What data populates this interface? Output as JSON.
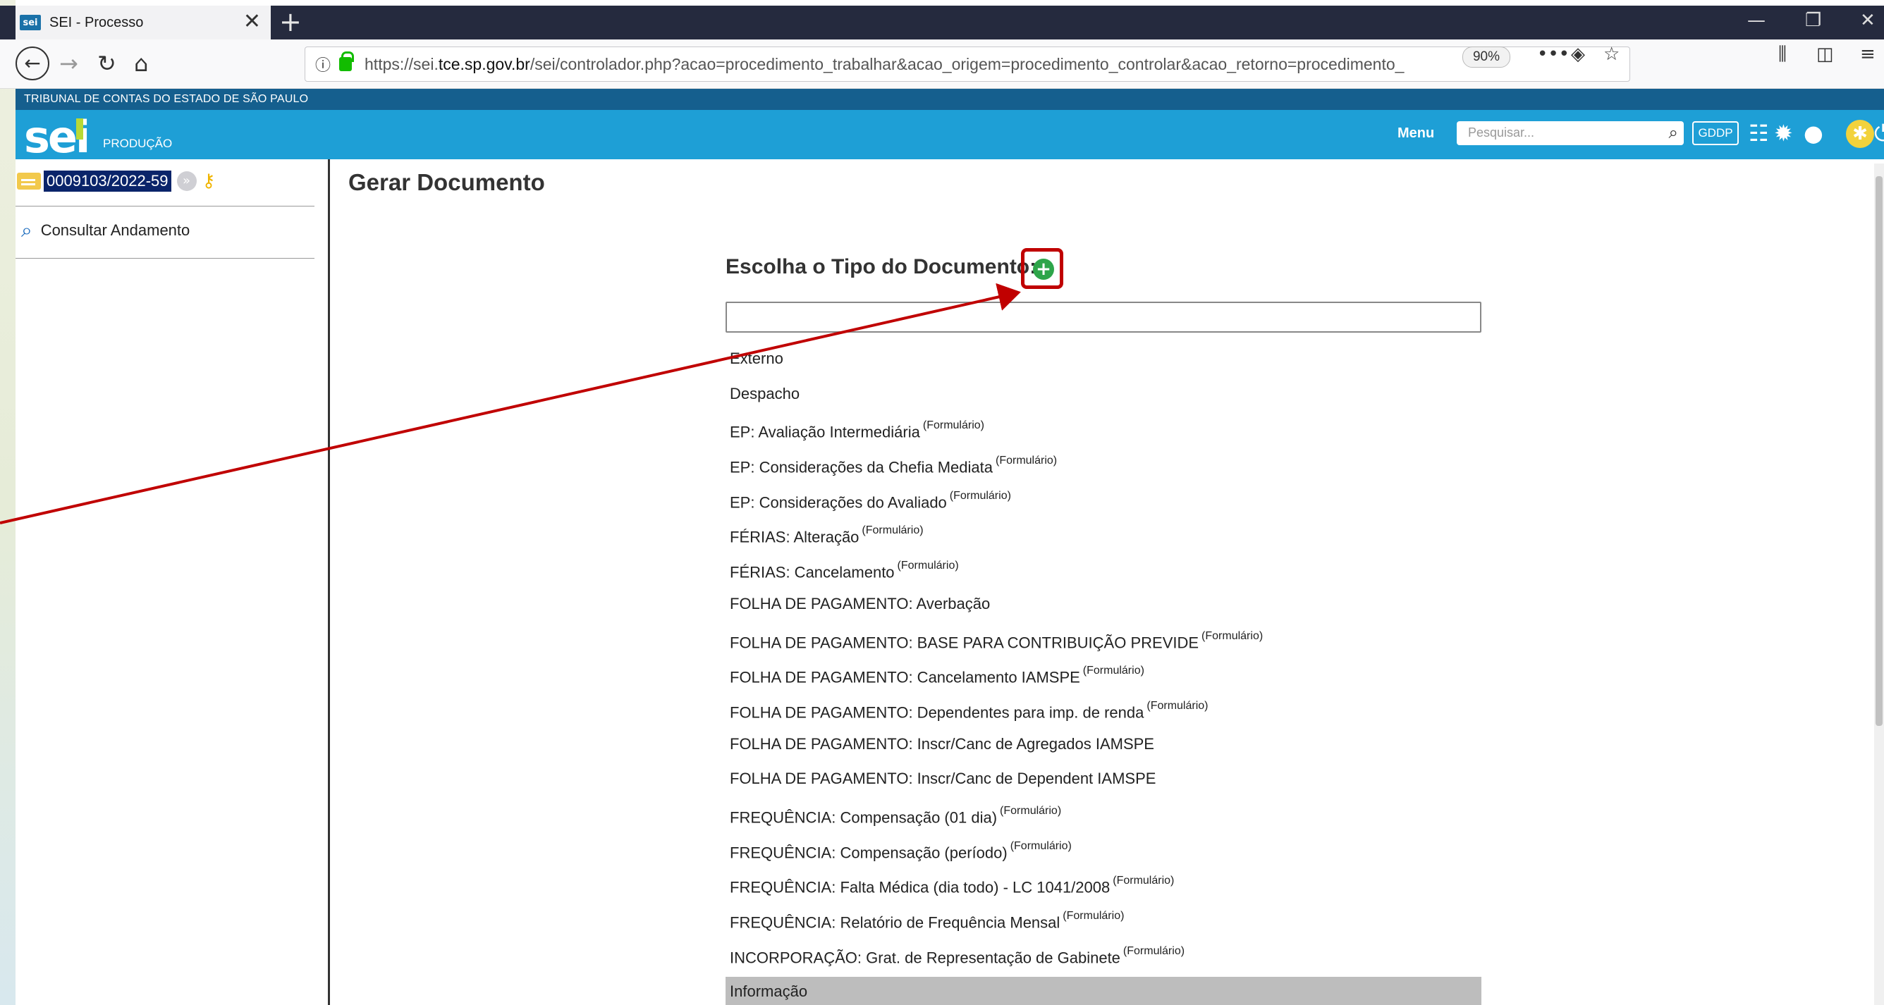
{
  "browser": {
    "tab_title": "SEI - Processo",
    "tab_close": "✕",
    "new_tab": "+",
    "favicon_text": "sei",
    "url_domain": "tce.sp.gov.br",
    "url_prefix": "https://sei.",
    "url_rest": "/sei/controlador.php?acao=procedimento_trabalhar&acao_origem=procedimento_controlar&acao_retorno=procedimento_",
    "zoom": "90%",
    "page_actions": "•••",
    "win_min": "—",
    "win_restore": "❐",
    "win_close": "✕"
  },
  "sei": {
    "org": "TRIBUNAL DE CONTAS DO ESTADO DE SÃO PAULO",
    "logo": "sei",
    "environment": "PRODUÇÃO",
    "menu_label": "Menu",
    "search_placeholder": "Pesquisar...",
    "unit": "GDDP"
  },
  "left_panel": {
    "process_number": "0009103/2022-59",
    "consultar_label": "Consultar Andamento"
  },
  "main": {
    "title": "Gerar Documento",
    "choose_label": "Escolha o Tipo do Documento:",
    "add_symbol": "+",
    "doc_types": [
      {
        "label": "Externo",
        "tag": ""
      },
      {
        "label": "Despacho",
        "tag": ""
      },
      {
        "label": "EP: Avaliação Intermediária",
        "tag": "(Formulário)"
      },
      {
        "label": "EP: Considerações da Chefia Mediata",
        "tag": "(Formulário)"
      },
      {
        "label": "EP: Considerações do Avaliado",
        "tag": "(Formulário)"
      },
      {
        "label": "FÉRIAS: Alteração",
        "tag": "(Formulário)"
      },
      {
        "label": "FÉRIAS: Cancelamento",
        "tag": "(Formulário)"
      },
      {
        "label": "FOLHA DE PAGAMENTO: Averbação",
        "tag": ""
      },
      {
        "label": "FOLHA DE PAGAMENTO: BASE PARA CONTRIBUIÇÃO PREVIDE",
        "tag": "(Formulário)"
      },
      {
        "label": "FOLHA DE PAGAMENTO: Cancelamento IAMSPE",
        "tag": "(Formulário)"
      },
      {
        "label": "FOLHA DE PAGAMENTO: Dependentes para imp. de renda",
        "tag": "(Formulário)"
      },
      {
        "label": "FOLHA DE PAGAMENTO: Inscr/Canc de Agregados IAMSPE",
        "tag": ""
      },
      {
        "label": "FOLHA DE PAGAMENTO: Inscr/Canc de Dependent IAMSPE",
        "tag": ""
      },
      {
        "label": "FREQUÊNCIA: Compensação (01 dia)",
        "tag": "(Formulário)"
      },
      {
        "label": "FREQUÊNCIA: Compensação (período)",
        "tag": "(Formulário)"
      },
      {
        "label": "FREQUÊNCIA: Falta Médica (dia todo) - LC 1041/2008",
        "tag": "(Formulário)"
      },
      {
        "label": "FREQUÊNCIA: Relatório de Frequência Mensal",
        "tag": "(Formulário)"
      },
      {
        "label": "INCORPORAÇÃO: Grat. de Representação de Gabinete",
        "tag": "(Formulário)"
      },
      {
        "label": "Informação",
        "tag": ""
      }
    ]
  },
  "colors": {
    "sei_blue": "#1e9fd6",
    "sei_dark": "#155f8e",
    "annotation_red": "#c00000",
    "add_green": "#2ea54a"
  }
}
